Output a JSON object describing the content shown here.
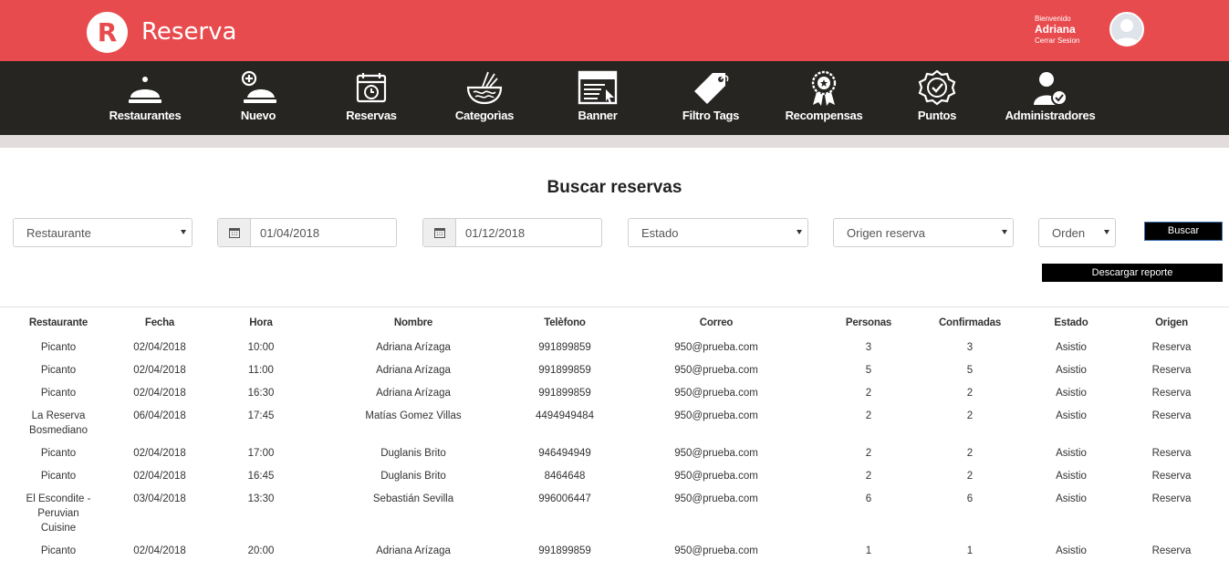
{
  "header": {
    "logo_letter": "R",
    "brand": "Reserva",
    "welcome": "Bienvenido",
    "user_name": "Adriana",
    "logout": "Cerrar Sesion"
  },
  "nav": [
    {
      "label": "Restaurantes",
      "icon": "cloche-icon"
    },
    {
      "label": "Nuevo",
      "icon": "cloche-plus-icon"
    },
    {
      "label": "Reservas",
      "icon": "calendar-clock-icon"
    },
    {
      "label": "Categorìas",
      "icon": "noodle-bowl-icon"
    },
    {
      "label": "Banner",
      "icon": "banner-icon"
    },
    {
      "label": "Filtro Tags",
      "icon": "tag-icon"
    },
    {
      "label": "Recompensas",
      "icon": "award-icon"
    },
    {
      "label": "Puntos",
      "icon": "badge-check-icon"
    },
    {
      "label": "Administradores",
      "icon": "admin-user-icon"
    }
  ],
  "page_title": "Buscar reservas",
  "filters": {
    "restaurante": "Restaurante",
    "date_from": "01/04/2018",
    "date_to": "01/12/2018",
    "estado": "Estado",
    "origen": "Origen reserva",
    "orden": "Orden",
    "search_button": "Buscar",
    "report_button": "Descargar reporte"
  },
  "table": {
    "headers": [
      "Restaurante",
      "Fecha",
      "Hora",
      "Nombre",
      "Telèfono",
      "Correo",
      "Personas",
      "Confirmadas",
      "Estado",
      "Origen"
    ],
    "rows": [
      [
        "Picanto",
        "02/04/2018",
        "10:00",
        "Adriana Arízaga",
        "991899859",
        "950@prueba.com",
        "3",
        "3",
        "Asistio",
        "Reserva"
      ],
      [
        "Picanto",
        "02/04/2018",
        "11:00",
        "Adriana Arízaga",
        "991899859",
        "950@prueba.com",
        "5",
        "5",
        "Asistio",
        "Reserva"
      ],
      [
        "Picanto",
        "02/04/2018",
        "16:30",
        "Adriana Arízaga",
        "991899859",
        "950@prueba.com",
        "2",
        "2",
        "Asistio",
        "Reserva"
      ],
      [
        "La Reserva\nBosmediano",
        "06/04/2018",
        "17:45",
        "Matías Gomez Villas",
        "4494949484",
        "950@prueba.com",
        "2",
        "2",
        "Asistio",
        "Reserva"
      ],
      [
        "Picanto",
        "02/04/2018",
        "17:00",
        "Duglanis Brito",
        "946494949",
        "950@prueba.com",
        "2",
        "2",
        "Asistio",
        "Reserva"
      ],
      [
        "Picanto",
        "02/04/2018",
        "16:45",
        "Duglanis Brito",
        "8464648",
        "950@prueba.com",
        "2",
        "2",
        "Asistio",
        "Reserva"
      ],
      [
        "El Escondite -\nPeruvian\nCuisine",
        "03/04/2018",
        "13:30",
        "Sebastián Sevilla",
        "996006447",
        "950@prueba.com",
        "6",
        "6",
        "Asistio",
        "Reserva"
      ],
      [
        "Picanto",
        "02/04/2018",
        "20:00",
        "Adriana Arízaga",
        "991899859",
        "950@prueba.com",
        "1",
        "1",
        "Asistio",
        "Reserva"
      ]
    ]
  },
  "colors": {
    "brand": "#e84b4e",
    "nav_bg": "#262522",
    "strip": "#e3dcdc"
  }
}
